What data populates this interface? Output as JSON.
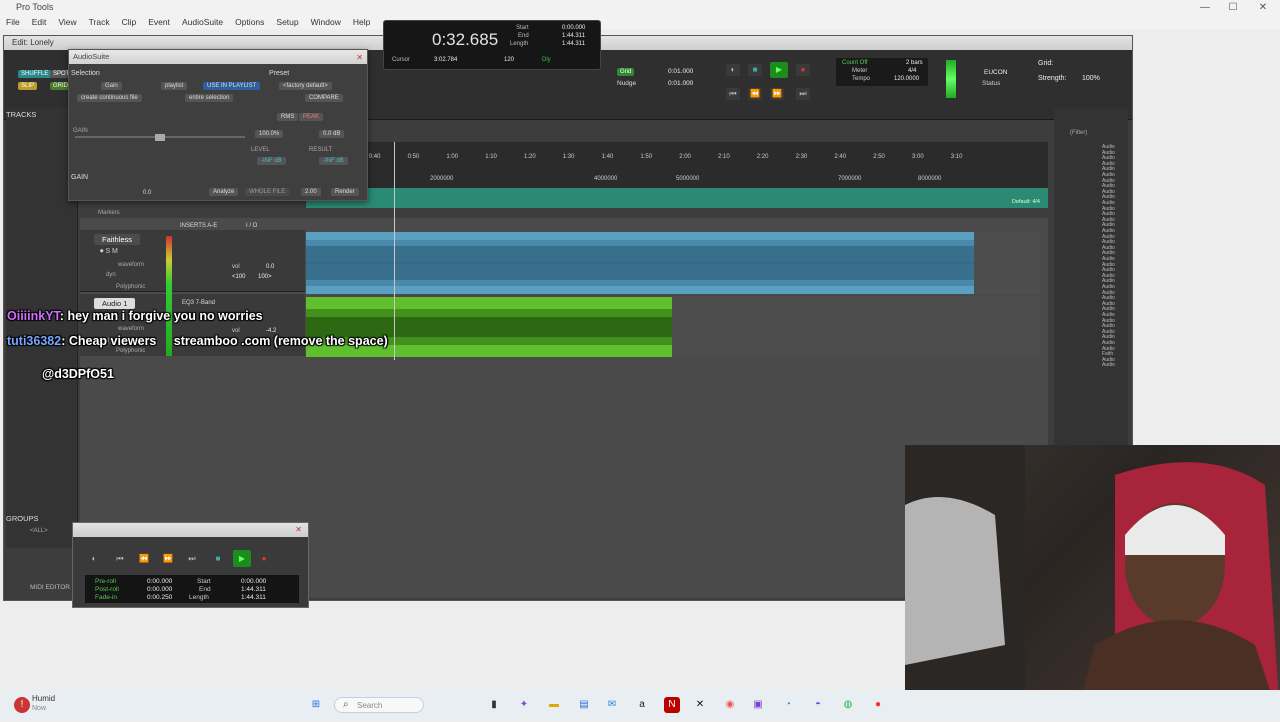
{
  "os": {
    "app_title": "Pro Tools",
    "menu": [
      "File",
      "Edit",
      "View",
      "Track",
      "Clip",
      "Event",
      "AudioSuite",
      "Options",
      "Setup",
      "Window",
      "Help"
    ]
  },
  "edit_window": {
    "title": "Edit: Lonely",
    "toolbar": {
      "shuffle": "SHUFFLE",
      "slip": "SLIP",
      "spot": "SPOT",
      "grid": "GRID",
      "main_counter": "0:32.685",
      "start_label": "Start",
      "end_label": "End",
      "length_label": "Length",
      "start": "0:00.000",
      "end": "1:44.311",
      "length": "1:44.311",
      "cursor_label": "Cursor",
      "cursor": "3:02.784",
      "tempo_val": "120",
      "dly_label": "Dly",
      "grid_btn": "Grid",
      "nudge_btn": "Nudge",
      "grid_val": "0:01.000",
      "nudge_val": "0:01.000",
      "count_off": "Count Off",
      "meter_label": "Meter",
      "tempo_label": "Tempo",
      "bars": "2 bars",
      "meter": "4/4",
      "tempo": "120.0000",
      "eucon": "EUCON",
      "status": "Status",
      "grid_label": "Grid:",
      "strength_label": "Strength:",
      "strength": "100%"
    },
    "tracks_label": "TRACKS",
    "groups_label": "GROUPS",
    "all_group": "<ALL>",
    "midi_editor": "MIDI EDITOR",
    "markers": "Markers",
    "inserts_label": "INSERTS A-E",
    "io_label": "I / O",
    "tracks": [
      {
        "name": "Faithless",
        "view": "waveform",
        "dyn": "dyn",
        "poly": "Polyphonic",
        "vol": "vol",
        "vol_val": "0.0",
        "pan_l": "<100",
        "pan_r": "100>"
      },
      {
        "name": "Audio 1",
        "view": "waveform",
        "dyn": "dyn",
        "poly": "Polyphonic",
        "vol": "vol",
        "vol_val": "-4.2",
        "insert": "EQ3 7-Band"
      }
    ],
    "ruler": {
      "min_secs": [
        "0:30",
        "0:40",
        "0:50",
        "1:00",
        "1:10",
        "1:20",
        "1:30",
        "1:40",
        "1:50",
        "2:00",
        "2:10",
        "2:20",
        "2:30",
        "2:40",
        "2:50",
        "3:00",
        "3:10"
      ],
      "samples": [
        "2000000",
        "4000000",
        "5000000",
        "7000000",
        "8000000"
      ],
      "default": "Default: 4/4"
    },
    "right_tracks": [
      "Audio",
      "Audio",
      "Audio",
      "Audio",
      "Audio",
      "Audio",
      "Audio",
      "Audio",
      "Audio",
      "Audio",
      "Audio",
      "Audio",
      "Audio",
      "Audio",
      "Audio",
      "Audio",
      "Audio",
      "Audio",
      "Audio",
      "Audio",
      "Audio",
      "Audio",
      "Audio",
      "Audio",
      "Audio",
      "Audio",
      "Audio",
      "Audio",
      "Audio",
      "Audio",
      "Audio",
      "Audio",
      "Audio",
      "Audio",
      "Audio",
      "Audio",
      "Audio",
      "Faith",
      "Audio",
      "Audio"
    ],
    "filter": "(Filter)"
  },
  "audiosuite": {
    "title": "AudioSuite",
    "selection": "Selection",
    "preset": "Preset",
    "plugin": "Gain",
    "playlist": "playlist",
    "use_in_playlist": "USE IN PLAYLIST",
    "factory_default": "<factory default>",
    "create_continuous": "create continuous file",
    "entire_selection": "entire selection",
    "compare": "COMPARE",
    "rms": "RMS",
    "peak": "PEAK",
    "gain_label": "GAIN",
    "pct": "100.0%",
    "db": "0.0 dB",
    "level": "LEVEL",
    "result": "RESULT",
    "level_val": "-INF dB",
    "result_val": "-INF dB",
    "gain_section": "GAIN",
    "handle_val": "0.0",
    "analyze": "Analyze",
    "whole_file": "WHOLE FILE",
    "render_len": "2.00",
    "render": "Render"
  },
  "transport": {
    "preroll": "Pre-roll",
    "postroll": "Post-roll",
    "fadein": "Fade-in",
    "preroll_val": "0:00.000",
    "postroll_val": "0:00.000",
    "fadein_val": "0:00.250",
    "start": "Start",
    "end": "End",
    "length": "Length",
    "start_val": "0:00.000",
    "end_val": "1:44.311",
    "length_val": "1:44.311"
  },
  "chat": [
    {
      "user": "OiiiinkYT",
      "user_color": "#d06cff",
      "msg": "hey man i forgive you no worries"
    },
    {
      "user": "tuti36382",
      "user_color": "#7aa7ff",
      "msg": "Cheap viewers     streamboo .com (remove the space)"
    },
    {
      "user": "",
      "user_color": "#ffffff",
      "msg": "@d3DPfO51"
    }
  ],
  "taskbar": {
    "weather": "Humid",
    "weather_sub": "Now",
    "search": "Search"
  },
  "colors": {
    "clip_blue": "#5aa0c0",
    "clip_green": "#5fbf2c",
    "ruler_green": "#2a8a74",
    "play_green": "#2fbf2f",
    "record_red": "#e03030"
  }
}
